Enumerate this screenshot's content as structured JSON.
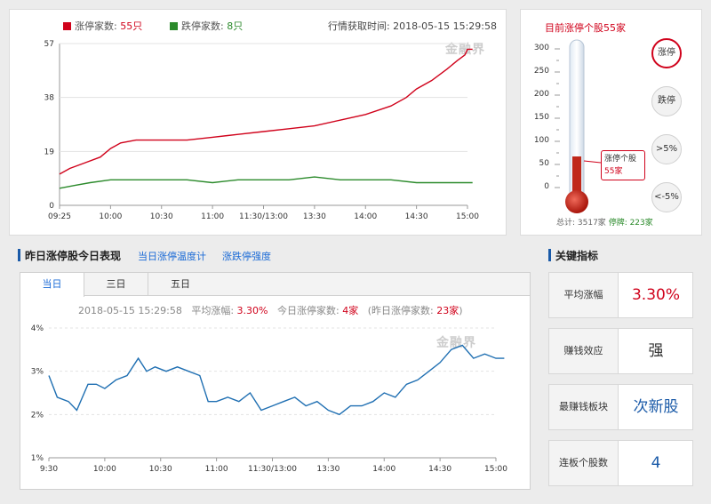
{
  "top_chart": {
    "legend_up_label": "涨停家数:",
    "legend_up_value": "55只",
    "legend_down_label": "跌停家数:",
    "legend_down_value": "8只",
    "fetch_time": "行情获取时间: 2018-05-15 15:29:58",
    "watermark": "金融界",
    "colors": {
      "up": "#d0021b",
      "down": "#2b8a2b"
    }
  },
  "thermometer": {
    "title": "目前涨停个股55家",
    "callout_label": "涨停个股",
    "callout_value": "55家",
    "buttons": [
      "涨停",
      "跌停",
      ">5%",
      "<-5%"
    ],
    "footer_total": "总计: 3517家",
    "footer_down": "停牌: 223家"
  },
  "section_left": {
    "title": "昨日涨停股今日表现",
    "link1": "当日涨停温度计",
    "link2": "涨跌停强度"
  },
  "section_right": {
    "title": "关键指标"
  },
  "bottom_chart": {
    "tabs": [
      "当日",
      "三日",
      "五日"
    ],
    "datetime": "2018-05-15 15:29:58",
    "avg_label": "平均涨幅:",
    "avg_value": "3.30%",
    "today_label": "今日涨停家数:",
    "today_value": "4家",
    "yest_label": "(昨日涨停家数:",
    "yest_value": "23家",
    "yest_close": ")",
    "watermark": "金融界"
  },
  "kpis": [
    {
      "label": "平均涨幅",
      "value": "3.30%",
      "color": "#d0021b"
    },
    {
      "label": "赚钱效应",
      "value": "强",
      "color": "#333333"
    },
    {
      "label": "最赚钱板块",
      "value": "次新股",
      "color": "#1a5aa8"
    },
    {
      "label": "连板个股数",
      "value": "4",
      "color": "#1a5aa8"
    }
  ],
  "chart_data": [
    {
      "type": "line",
      "x_ticks": [
        "09:25",
        "10:00",
        "10:30",
        "11:00",
        "11:30/13:00",
        "13:30",
        "14:00",
        "14:30",
        "15:00"
      ],
      "y_ticks": [
        0,
        19,
        38,
        57
      ],
      "ylim": [
        0,
        57
      ],
      "series": [
        {
          "name": "涨停家数",
          "color": "#d0021b",
          "x": [
            0,
            0.2,
            0.5,
            0.8,
            1,
            1.2,
            1.5,
            2,
            2.5,
            3,
            3.5,
            4,
            4.5,
            5,
            5.5,
            6,
            6.5,
            6.8,
            7,
            7.3,
            7.6,
            7.8,
            7.95,
            8,
            8.1
          ],
          "y": [
            11,
            13,
            15,
            17,
            20,
            22,
            23,
            23,
            23,
            24,
            25,
            26,
            27,
            28,
            30,
            32,
            35,
            38,
            41,
            44,
            48,
            51,
            53,
            55,
            55
          ]
        },
        {
          "name": "跌停家数",
          "color": "#2b8a2b",
          "x": [
            0,
            0.3,
            0.6,
            1,
            1.5,
            2,
            2.5,
            3,
            3.5,
            4,
            4.5,
            5,
            5.5,
            6,
            6.5,
            7,
            7.5,
            8,
            8.1
          ],
          "y": [
            6,
            7,
            8,
            9,
            9,
            9,
            9,
            8,
            9,
            9,
            9,
            10,
            9,
            9,
            9,
            8,
            8,
            8,
            8
          ]
        }
      ]
    },
    {
      "type": "line",
      "x_ticks": [
        "9:30",
        "10:00",
        "10:30",
        "11:00",
        "11:30/13:00",
        "13:30",
        "14:00",
        "14:30",
        "15:00"
      ],
      "y_ticks": [
        "1%",
        "2%",
        "3%",
        "4%"
      ],
      "ylim": [
        1,
        4
      ],
      "series": [
        {
          "color": "#1f6fb2",
          "x": [
            0,
            0.15,
            0.35,
            0.5,
            0.7,
            0.85,
            1,
            1.2,
            1.4,
            1.6,
            1.75,
            1.9,
            2.1,
            2.3,
            2.5,
            2.7,
            2.85,
            3,
            3.2,
            3.4,
            3.6,
            3.8,
            4,
            4.2,
            4.4,
            4.6,
            4.8,
            5,
            5.2,
            5.4,
            5.6,
            5.8,
            6,
            6.2,
            6.4,
            6.6,
            6.8,
            7,
            7.2,
            7.4,
            7.6,
            7.8,
            8,
            8.15
          ],
          "y": [
            2.9,
            2.4,
            2.3,
            2.1,
            2.7,
            2.7,
            2.6,
            2.8,
            2.9,
            3.3,
            3.0,
            3.1,
            3.0,
            3.1,
            3.0,
            2.9,
            2.3,
            2.3,
            2.4,
            2.3,
            2.5,
            2.1,
            2.2,
            2.3,
            2.4,
            2.2,
            2.3,
            2.1,
            2.0,
            2.2,
            2.2,
            2.3,
            2.5,
            2.4,
            2.7,
            2.8,
            3.0,
            3.2,
            3.5,
            3.6,
            3.3,
            3.4,
            3.3,
            3.3
          ]
        }
      ]
    }
  ]
}
